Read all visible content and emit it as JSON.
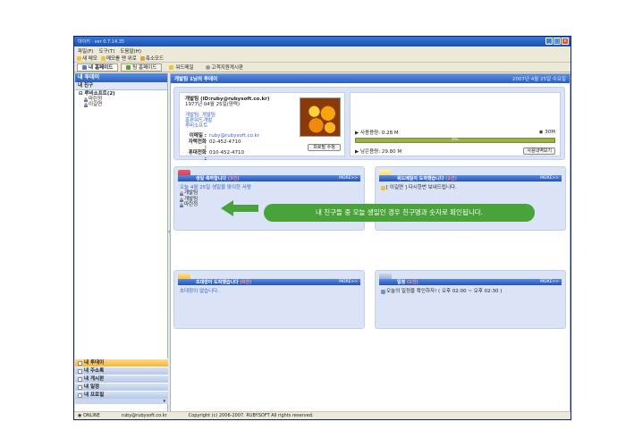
{
  "window": {
    "title": "마이키 · ver 0.7.14.35"
  },
  "menu": [
    "파일(F)",
    "도구(T)",
    "도움말(H)"
  ],
  "toolbar": [
    "새 메모",
    "메모를 맨 위로",
    "축소모드"
  ],
  "tabs": {
    "mine": "내 홈페이드",
    "team": "팀 홈페이드",
    "word": "워드메일",
    "board": "고객지원게시판"
  },
  "sidebar": {
    "title": "내 투데이",
    "friends_label": "내 친구",
    "group": "루비소프트(2)",
    "members": [
      "마린정",
      "이길연"
    ],
    "nav": [
      "내 투데이",
      "내 주소록",
      "내 게시판",
      "내 일정",
      "내 프로필"
    ]
  },
  "main": {
    "header_title": "개발팀 1님의 투데이",
    "date": "2007년 4월 25일 수요일",
    "profile": {
      "name": "개발팀 (ID:ruby@rubysoft.co.kr)",
      "birth": "1977년 04월 25일(양력)",
      "orgs": [
        "개발팀: 개발팀",
        "홈판워드개발",
        "루비소프트"
      ],
      "email_label": "이메일 :",
      "email": "ruby@rubysoft.co.kr",
      "office_label": "자택전화 :",
      "office": "02-452-4710",
      "mobile_label": "휴대전화 :",
      "mobile": "010-452-4710",
      "edit_button": "프로필 수정"
    },
    "storage": {
      "used_label": "사용용량: 0.28 M",
      "total": "30M",
      "percent": "0%",
      "remain_label": "남은용량: 29.80 M",
      "history_button": "사용내역보기"
    }
  },
  "panels": {
    "birthday": {
      "title": "생일 축하합니다",
      "count": "(3건)",
      "more": "MORE>>",
      "intro": "오늘 4월 25일 생일을 맞이한 사람",
      "people": [
        "개발팀",
        "개발팀",
        "마린정"
      ]
    },
    "wordmail": {
      "title": "워드메일이 도착했습니다",
      "count": "(1건)",
      "more": "MORE>>",
      "item": "[ 이길연 ] 다시한번 보내드립니다."
    },
    "invite": {
      "title": "초대장이 도착했습니다",
      "count": "(0건)",
      "more": "MORE>>",
      "empty": "초대장이 없습니다."
    },
    "schedule": {
      "title": "일정",
      "count": "(1건)",
      "more": "MORE>>",
      "item": "오늘의 일정을 확인하자! ( 오후 02:00 ~ 오후 02:30 )"
    }
  },
  "callout": "내 친구들 중 오늘 생일인 경우 친구명과 숫자로 확인됩니다.",
  "status": {
    "state": "ONLINE",
    "user": "ruby@rubysoft.co.kr",
    "copyright": "Copyright (c) 2006-2007. RUBYSOFT All rights reserved."
  },
  "colors": {
    "accent": "#2a5fc0",
    "panel_bg": "#dbe4f7",
    "callout": "#4aa23a"
  }
}
